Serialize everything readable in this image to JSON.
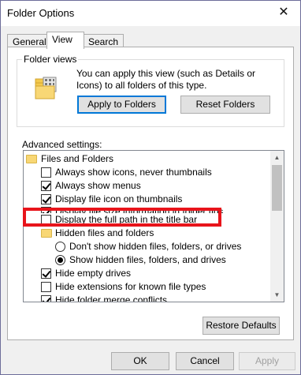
{
  "window": {
    "title": "Folder Options"
  },
  "tabs": [
    "General",
    "View",
    "Search"
  ],
  "folder_views": {
    "label": "Folder views",
    "description": "You can apply this view (such as Details or Icons) to all folders of this type.",
    "apply_button": "Apply to Folders",
    "reset_button": "Reset Folders"
  },
  "advanced": {
    "label": "Advanced settings:",
    "items": [
      {
        "type": "folder",
        "label": "Files and Folders"
      },
      {
        "type": "checkbox",
        "checked": false,
        "label": "Always show icons, never thumbnails"
      },
      {
        "type": "checkbox",
        "checked": true,
        "label": "Always show menus"
      },
      {
        "type": "checkbox",
        "checked": true,
        "label": "Display file icon on thumbnails"
      },
      {
        "type": "checkbox",
        "checked": true,
        "label": "Display file size information in folder tips"
      },
      {
        "type": "checkbox",
        "checked": false,
        "label": "Display the full path in the title bar"
      },
      {
        "type": "folder",
        "label": "Hidden files and folders"
      },
      {
        "type": "radio",
        "checked": false,
        "label": "Don't show hidden files, folders, or drives"
      },
      {
        "type": "radio",
        "checked": true,
        "label": "Show hidden files, folders, and drives"
      },
      {
        "type": "checkbox",
        "checked": true,
        "label": "Hide empty drives"
      },
      {
        "type": "checkbox",
        "checked": false,
        "label": "Hide extensions for known file types"
      },
      {
        "type": "checkbox",
        "checked": true,
        "label": "Hide folder merge conflicts"
      }
    ]
  },
  "buttons": {
    "restore_defaults": "Restore Defaults",
    "ok": "OK",
    "cancel": "Cancel",
    "apply": "Apply"
  },
  "colors": {
    "highlight": "#e8141b",
    "focus": "#0078d7"
  }
}
